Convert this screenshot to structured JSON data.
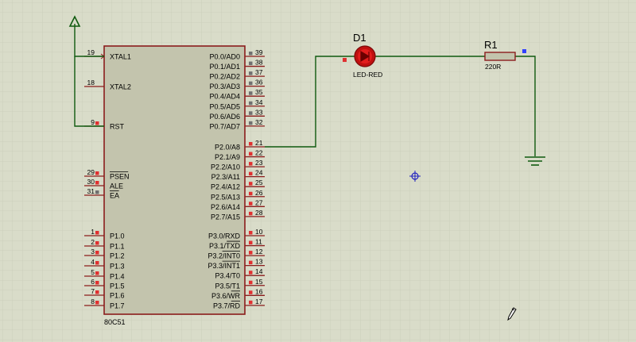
{
  "colors": {
    "background": "#d9dcc9",
    "grid": "#c3c6b3",
    "chip_fill": "#c3c4ad",
    "chip_border": "#8b1c1c",
    "pin_line": "#8b1c1c",
    "wire": "#0f5a0f",
    "pin_marker_red": "#e03030",
    "pin_marker_gray": "#707070",
    "text": "#000000",
    "led_red": "#d01010",
    "probe": "#2020c0"
  },
  "chip": {
    "name": "80C51",
    "left_pins": [
      {
        "num": "19",
        "label": "XTAL1",
        "overline": false,
        "marker": "clock",
        "connected": true
      },
      {
        "num": "18",
        "label": "XTAL2",
        "overline": false,
        "marker": "none",
        "connected": false
      },
      {
        "num": "9",
        "label": "RST",
        "overline": false,
        "marker": "red",
        "connected": true
      },
      {
        "num": "29",
        "label": "PSEN",
        "overline": true,
        "marker": "red",
        "connected": false
      },
      {
        "num": "30",
        "label": "ALE",
        "overline": false,
        "marker": "red",
        "connected": false
      },
      {
        "num": "31",
        "label": "EA",
        "overline": true,
        "marker": "gray",
        "connected": false
      },
      {
        "num": "1",
        "label": "P1.0",
        "overline": false,
        "marker": "red",
        "connected": false
      },
      {
        "num": "2",
        "label": "P1.1",
        "overline": false,
        "marker": "red",
        "connected": false
      },
      {
        "num": "3",
        "label": "P1.2",
        "overline": false,
        "marker": "red",
        "connected": false
      },
      {
        "num": "4",
        "label": "P1.3",
        "overline": false,
        "marker": "red",
        "connected": false
      },
      {
        "num": "5",
        "label": "P1.4",
        "overline": false,
        "marker": "red",
        "connected": false
      },
      {
        "num": "6",
        "label": "P1.5",
        "overline": false,
        "marker": "red",
        "connected": false
      },
      {
        "num": "7",
        "label": "P1.6",
        "overline": false,
        "marker": "red",
        "connected": false
      },
      {
        "num": "8",
        "label": "P1.7",
        "overline": false,
        "marker": "red",
        "connected": false
      }
    ],
    "right_pins": [
      {
        "num": "39",
        "label": "P0.0/AD0",
        "marker": "gray",
        "connected": false
      },
      {
        "num": "38",
        "label": "P0.1/AD1",
        "marker": "gray",
        "connected": false
      },
      {
        "num": "37",
        "label": "P0.2/AD2",
        "marker": "gray",
        "connected": false
      },
      {
        "num": "36",
        "label": "P0.3/AD3",
        "marker": "gray",
        "connected": false
      },
      {
        "num": "35",
        "label": "P0.4/AD4",
        "marker": "gray",
        "connected": false
      },
      {
        "num": "34",
        "label": "P0.5/AD5",
        "marker": "gray",
        "connected": false
      },
      {
        "num": "33",
        "label": "P0.6/AD6",
        "marker": "gray",
        "connected": false
      },
      {
        "num": "32",
        "label": "P0.7/AD7",
        "marker": "gray",
        "connected": false
      },
      {
        "num": "21",
        "label": "P2.0/A8",
        "marker": "red",
        "connected": true
      },
      {
        "num": "22",
        "label": "P2.1/A9",
        "marker": "red",
        "connected": false
      },
      {
        "num": "23",
        "label": "P2.2/A10",
        "marker": "red",
        "connected": false
      },
      {
        "num": "24",
        "label": "P2.3/A11",
        "marker": "red",
        "connected": false
      },
      {
        "num": "25",
        "label": "P2.4/A12",
        "marker": "red",
        "connected": false
      },
      {
        "num": "26",
        "label": "P2.5/A13",
        "marker": "red",
        "connected": false
      },
      {
        "num": "27",
        "label": "P2.6/A14",
        "marker": "red",
        "connected": false
      },
      {
        "num": "28",
        "label": "P2.7/A15",
        "marker": "red",
        "connected": false
      },
      {
        "num": "10",
        "label": "P3.0/RXD",
        "marker": "red",
        "connected": false
      },
      {
        "num": "11",
        "label": "P3.1/TXD",
        "overline_part": "TXD",
        "marker": "red",
        "connected": false
      },
      {
        "num": "12",
        "label": "P3.2/INT0",
        "overline_part": "INT0",
        "marker": "red",
        "connected": false
      },
      {
        "num": "13",
        "label": "P3.3/INT1",
        "overline_part": "INT1",
        "marker": "red",
        "connected": false
      },
      {
        "num": "14",
        "label": "P3.4/T0",
        "marker": "red",
        "connected": false
      },
      {
        "num": "15",
        "label": "P3.5/T1",
        "marker": "red",
        "connected": false
      },
      {
        "num": "16",
        "label": "P3.6/WR",
        "overline_part": "WR",
        "marker": "red",
        "connected": false
      },
      {
        "num": "17",
        "label": "P3.7/RD",
        "overline_part": "RD",
        "marker": "red",
        "connected": false
      }
    ]
  },
  "led": {
    "ref": "D1",
    "value": "LED-RED"
  },
  "resistor": {
    "ref": "R1",
    "value": "220R"
  },
  "ground": {
    "name": "ground"
  },
  "power": {
    "name": "power-terminal"
  },
  "icons": {
    "probe": "crosshair-probe-icon",
    "cursor": "pencil-cursor-icon"
  }
}
